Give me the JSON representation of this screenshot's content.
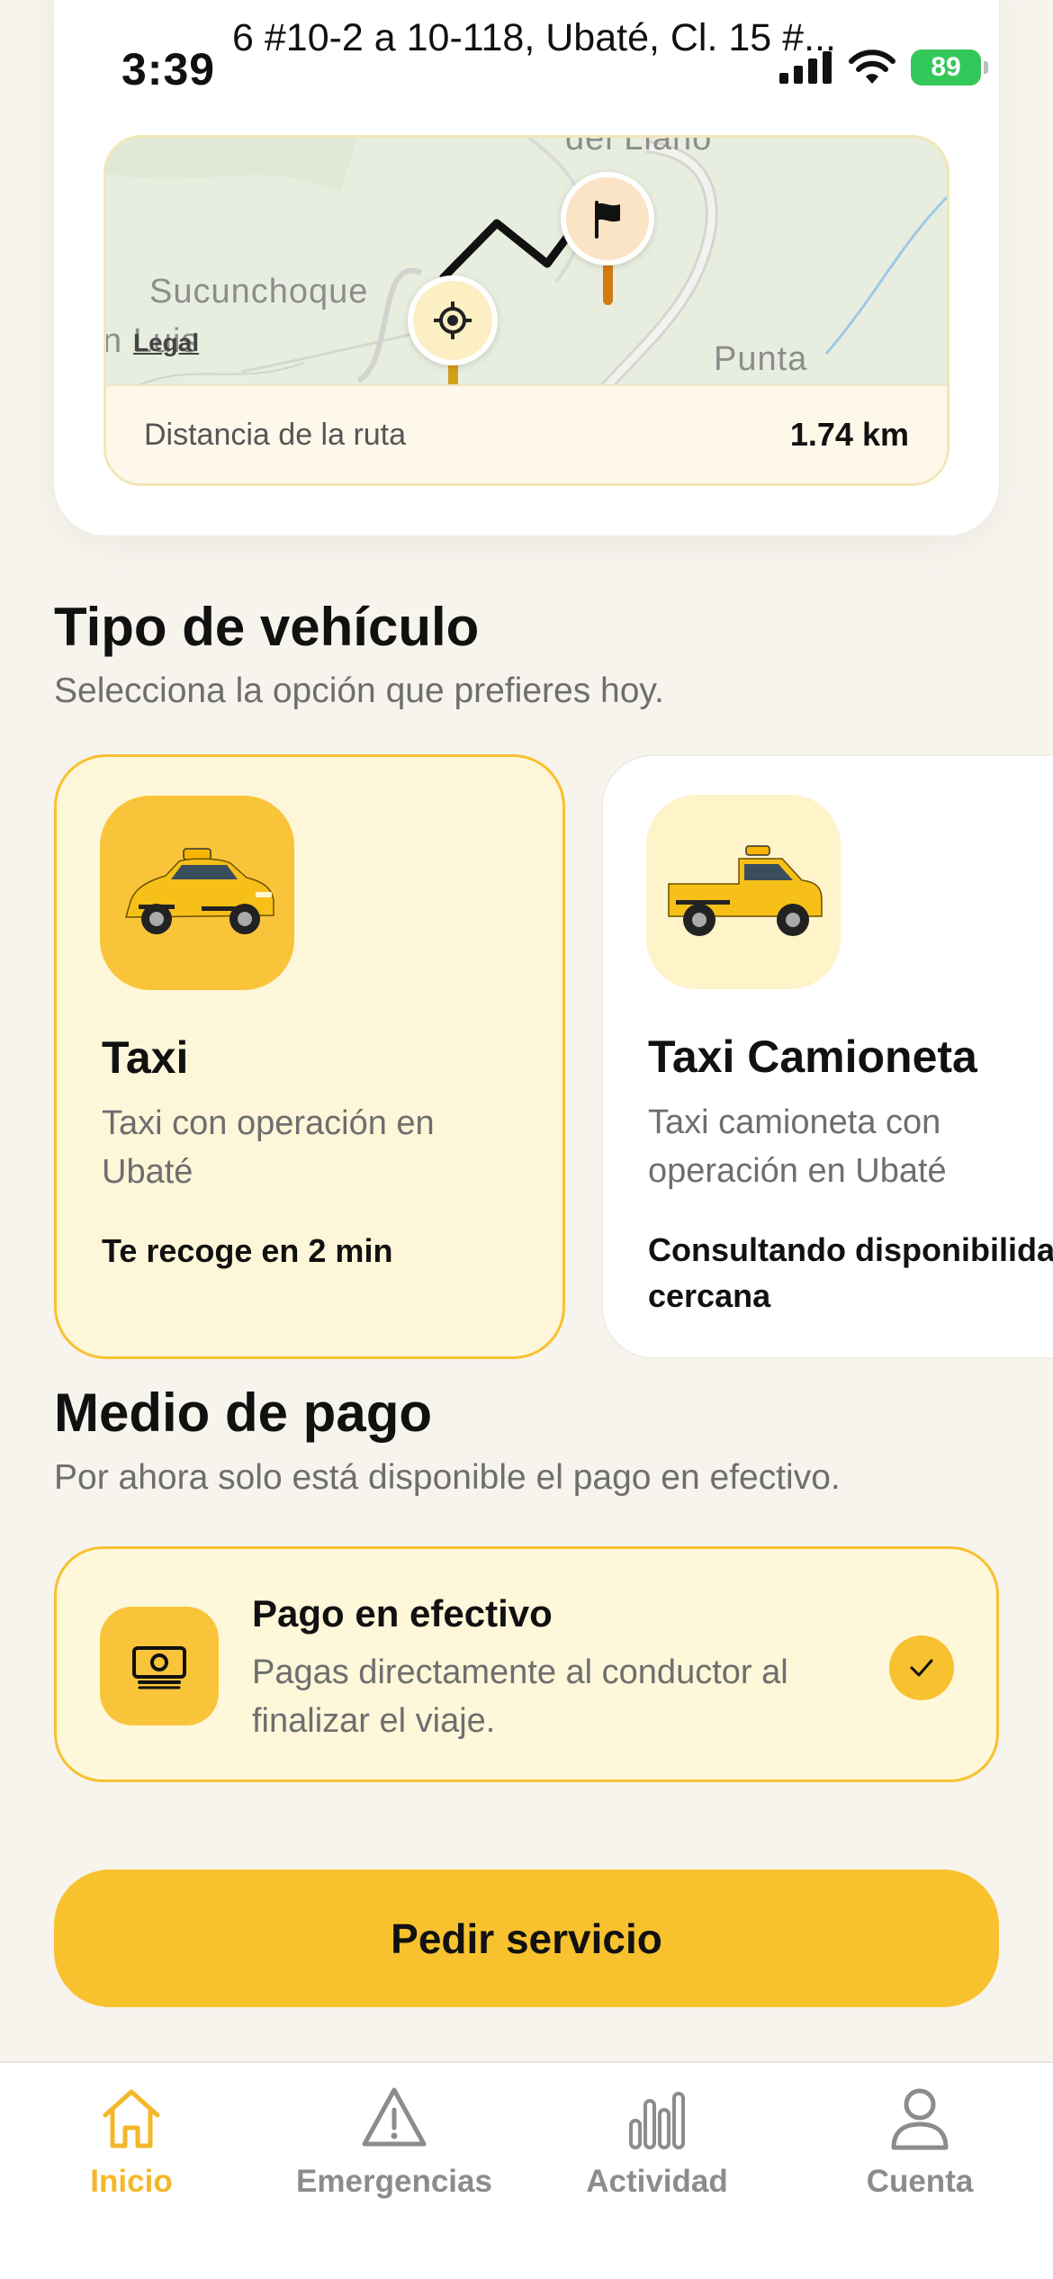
{
  "status_bar": {
    "time": "3:39",
    "battery": "89"
  },
  "route": {
    "address": "6 #10-2 a 10-118, Ubaté, Cl. 15 #...",
    "map": {
      "labels": {
        "top": "del Llano",
        "left": "Sucunchoque",
        "left_fragment": "n Luis",
        "right": "Punta"
      },
      "legal": "Legal"
    },
    "distance_label": "Distancia de la ruta",
    "distance_value": "1.74 km"
  },
  "vehicle_section": {
    "title": "Tipo de vehículo",
    "subtitle": "Selecciona la opción que prefieres hoy.",
    "options": [
      {
        "name": "Taxi",
        "description": "Taxi con operación en Ubaté",
        "eta": "Te recoge en 2 min",
        "selected": true
      },
      {
        "name": "Taxi Camioneta",
        "description": "Taxi camioneta con operación en Ubaté",
        "eta": "Consultando disponibilidad cercana",
        "selected": false
      }
    ]
  },
  "payment_section": {
    "title": "Medio de pago",
    "subtitle": "Por ahora solo está disponible el pago en efectivo.",
    "method": {
      "title": "Pago en efectivo",
      "description": "Pagas directamente al conductor al finalizar el viaje.",
      "icon": "cash-icon",
      "selected": true
    }
  },
  "cta": {
    "label": "Pedir servicio"
  },
  "tabbar": {
    "items": [
      {
        "label": "Inicio",
        "icon": "home-icon",
        "active": true
      },
      {
        "label": "Emergencias",
        "icon": "warning-icon",
        "active": false
      },
      {
        "label": "Actividad",
        "icon": "bar-chart-icon",
        "active": false
      },
      {
        "label": "Cuenta",
        "icon": "person-icon",
        "active": false
      }
    ]
  },
  "colors": {
    "accent": "#F8C22F",
    "active_tab": "#F4B72A",
    "background": "#F7F4EE",
    "selected_card_bg": "#FEF6D9",
    "battery": "#34C759"
  }
}
